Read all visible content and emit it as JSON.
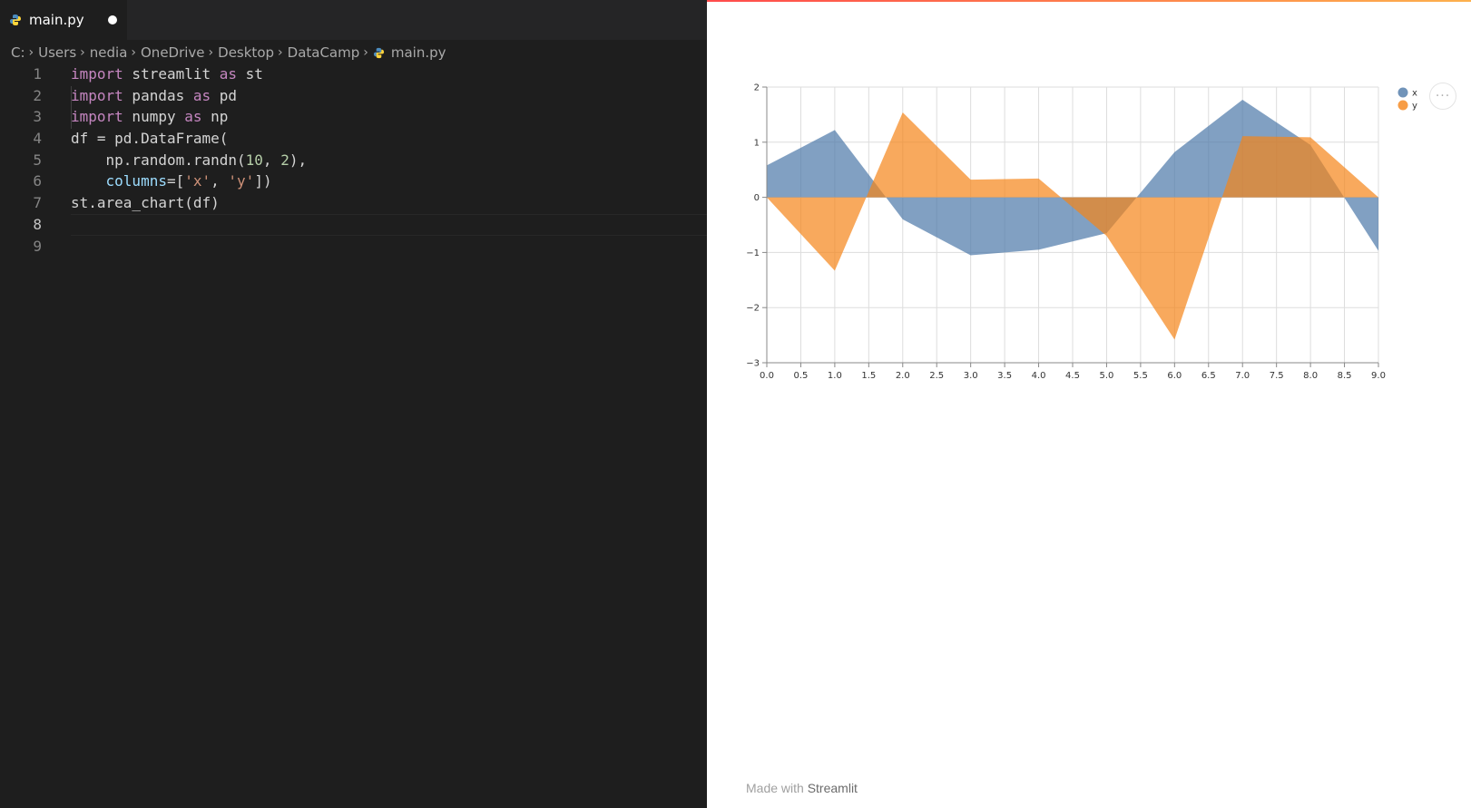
{
  "editor": {
    "tab": {
      "filename": "main.py"
    },
    "breadcrumb": [
      "C:",
      "Users",
      "nedia",
      "OneDrive",
      "Desktop",
      "DataCamp",
      "main.py"
    ],
    "active_line": 8,
    "lines": [
      {
        "num": "1",
        "tokens": [
          [
            "kw",
            "import"
          ],
          [
            "id",
            " streamlit "
          ],
          [
            "kw",
            "as"
          ],
          [
            "id",
            " st"
          ]
        ]
      },
      {
        "num": "2",
        "tokens": [
          [
            "kw",
            "import"
          ],
          [
            "id",
            " pandas "
          ],
          [
            "kw",
            "as"
          ],
          [
            "id",
            " pd"
          ]
        ]
      },
      {
        "num": "3",
        "tokens": [
          [
            "kw",
            "import"
          ],
          [
            "id",
            " numpy "
          ],
          [
            "kw",
            "as"
          ],
          [
            "id",
            " np"
          ]
        ]
      },
      {
        "num": "4",
        "tokens": [
          [
            "id",
            "df = pd.DataFrame("
          ]
        ]
      },
      {
        "num": "5",
        "tokens": [
          [
            "id",
            "    np.random.randn("
          ],
          [
            "num",
            "10"
          ],
          [
            "id",
            ", "
          ],
          [
            "num",
            "2"
          ],
          [
            "id",
            "),"
          ]
        ]
      },
      {
        "num": "6",
        "tokens": [
          [
            "id",
            "    "
          ],
          [
            "attr",
            "columns"
          ],
          [
            "id",
            "=["
          ],
          [
            "str",
            "'x'"
          ],
          [
            "id",
            ", "
          ],
          [
            "str",
            "'y'"
          ],
          [
            "id",
            "])"
          ]
        ]
      },
      {
        "num": "7",
        "tokens": [
          [
            "id",
            "st.area_chart(df)"
          ]
        ]
      },
      {
        "num": "8",
        "tokens": []
      },
      {
        "num": "9",
        "tokens": []
      }
    ]
  },
  "app": {
    "menu_icon": "···",
    "footer": {
      "prefix": "Made with ",
      "brand": "Streamlit"
    }
  },
  "colors": {
    "x": "#4c78a8",
    "y": "#f58518",
    "accent_from": "#ff4b4b",
    "accent_to": "#fdb14d"
  },
  "chart_data": {
    "type": "area",
    "x": [
      0,
      1,
      2,
      3,
      4,
      5,
      6,
      7,
      8,
      9
    ],
    "series": [
      {
        "name": "x",
        "values": [
          0.58,
          1.22,
          -0.4,
          -1.05,
          -0.95,
          -0.65,
          0.82,
          1.77,
          0.95,
          -0.97
        ]
      },
      {
        "name": "y",
        "values": [
          0.0,
          -1.33,
          1.54,
          0.32,
          0.34,
          -0.7,
          -2.58,
          1.11,
          1.09,
          0.0
        ]
      }
    ],
    "x_ticks": [
      "0.0",
      "0.5",
      "1.0",
      "1.5",
      "2.0",
      "2.5",
      "3.0",
      "3.5",
      "4.0",
      "4.5",
      "5.0",
      "5.5",
      "6.0",
      "6.5",
      "7.0",
      "7.5",
      "8.0",
      "8.5",
      "9.0"
    ],
    "y_ticks": [
      "2",
      "1",
      "0",
      "−1",
      "−2",
      "−3"
    ],
    "xlim": [
      0,
      9
    ],
    "ylim": [
      -3,
      2
    ],
    "grid": true,
    "legend": "top-right"
  }
}
